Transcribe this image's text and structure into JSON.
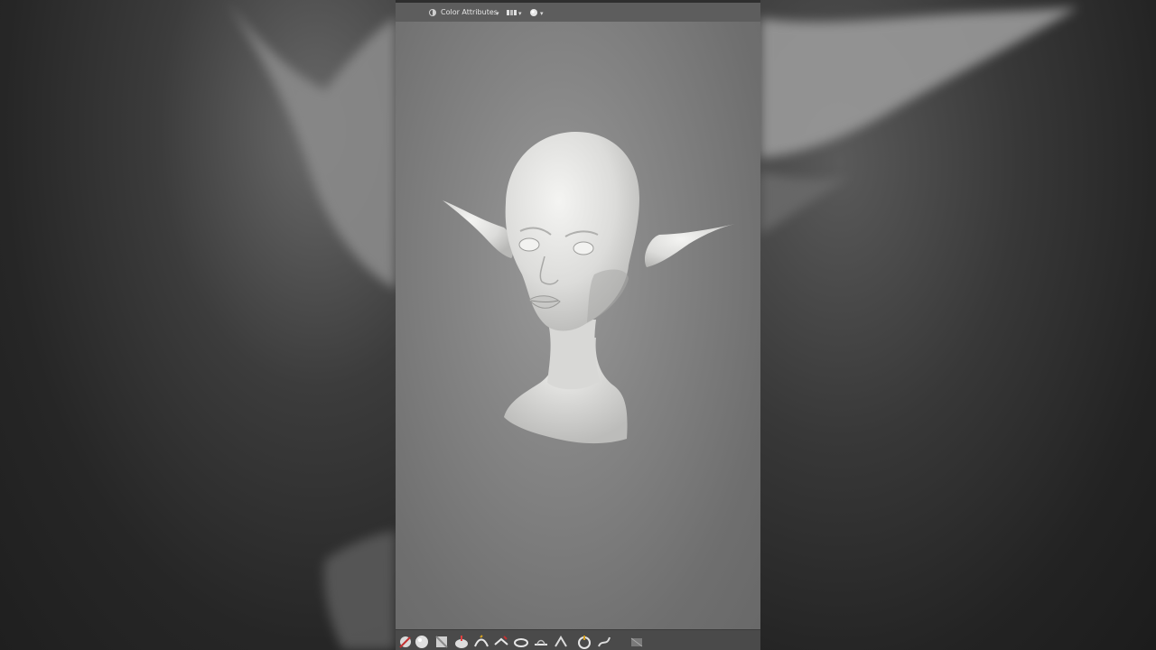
{
  "header": {
    "color_mode_label": "Color Attributes"
  },
  "icons": {
    "header": [
      "viewport-shading-icon",
      "overlay-icon",
      "sphere-shading-icon"
    ],
    "toolbar": [
      "draw-brush-icon",
      "clay-brush-icon",
      "clay-strips-icon",
      "inflate-icon",
      "blob-icon",
      "crease-icon",
      "smooth-icon",
      "flatten-icon",
      "pinch-icon",
      "grab-icon",
      "snake-hook-icon",
      "mask-icon"
    ]
  },
  "colors": {
    "viewport_center": "#9a9a9a",
    "viewport_edge": "#686868",
    "header_bg": "#5d5d5d",
    "model_color": "#e8e8e6"
  }
}
